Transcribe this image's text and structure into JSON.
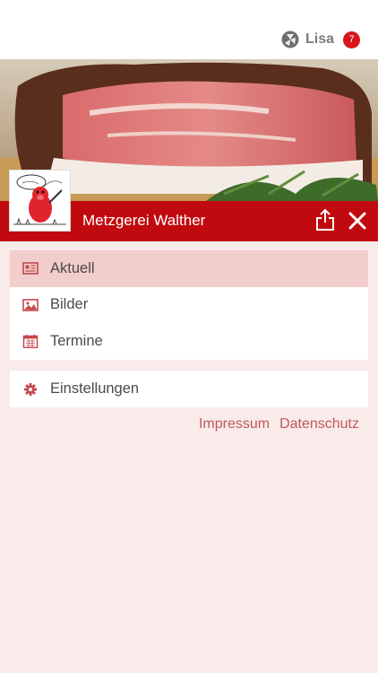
{
  "header": {
    "user_name": "Lisa",
    "notification_count": "7",
    "brand_icon": "app-logo-icon"
  },
  "shop": {
    "title": "Metzgerei Walther",
    "avatar_icon": "pig-mascot-logo"
  },
  "menu": {
    "items": [
      {
        "label": "Aktuell",
        "icon": "newspaper-icon",
        "active": true
      },
      {
        "label": "Bilder",
        "icon": "image-icon",
        "active": false
      },
      {
        "label": "Termine",
        "icon": "calendar-icon",
        "active": false
      }
    ],
    "settings_label": "Einstellungen"
  },
  "footer_links": {
    "imprint": "Impressum",
    "privacy": "Datenschutz"
  },
  "colors": {
    "accent": "#c10a0f",
    "active_row": "#f1cdcb",
    "background": "#f9ebea",
    "icon": "#c4484d"
  }
}
